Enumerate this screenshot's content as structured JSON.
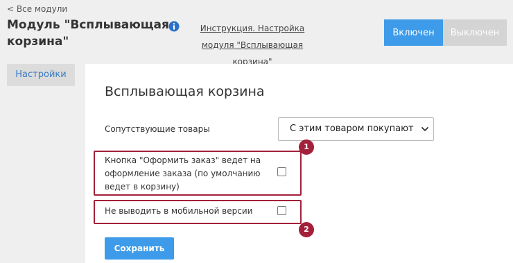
{
  "header": {
    "back_link": "< Все модули",
    "module_title": "Модуль \"Всплывающая корзина\"",
    "instruction_link": "Инструкция. Настройка модуля \"Всплывающая корзина\"",
    "toggle": {
      "on_label": "Включен",
      "off_label": "Выключен",
      "selected": "Включен"
    }
  },
  "sidebar": {
    "tabs": [
      {
        "label": "Настройки",
        "active": true
      }
    ]
  },
  "panel": {
    "title": "Всплывающая корзина",
    "fields": {
      "related_products": {
        "label": "Сопутствующие товары",
        "selected_value": "С этим товаром покупают"
      },
      "checkout_button": {
        "label": "Кнопка \"Оформить заказ\" ведет на оформление заказа (по умолчанию ведет в корзину)",
        "checked": false
      },
      "hide_mobile": {
        "label": "Не выводить в мобильной версии",
        "checked": false
      }
    },
    "save_label": "Сохранить"
  },
  "annotations": {
    "badge_1": "1",
    "badge_2": "2"
  },
  "colors": {
    "accent": "#3d9be9",
    "highlight": "#a3203b",
    "info_icon": "#2a6fc9"
  },
  "icons": [
    "info-icon",
    "chevron-down-icon"
  ]
}
